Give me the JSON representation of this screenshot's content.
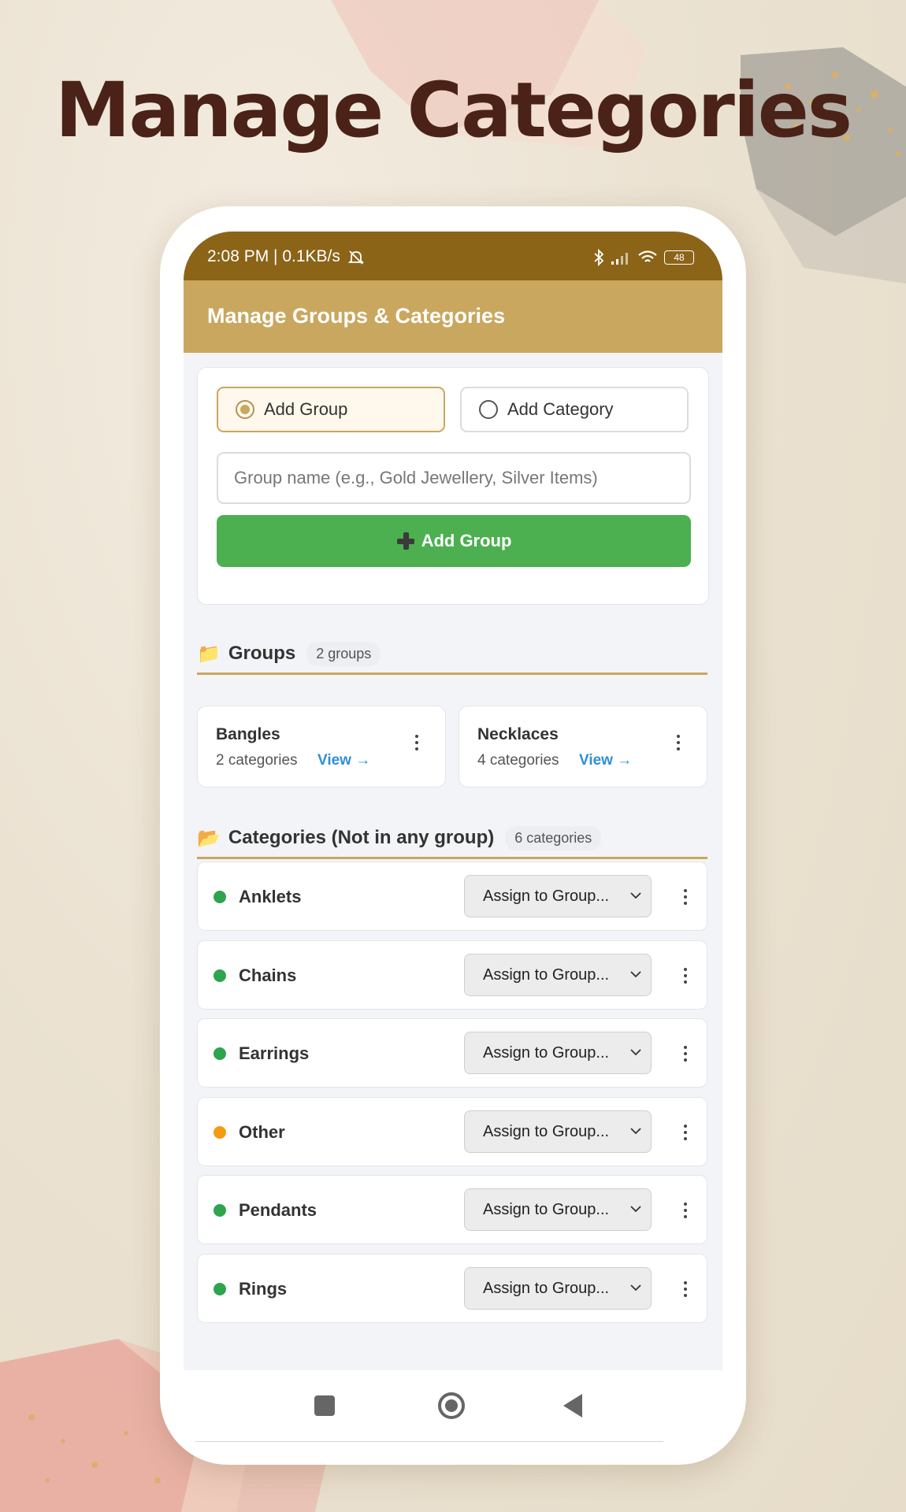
{
  "hero": {
    "title": "Manage Categories"
  },
  "status_bar": {
    "time": "2:08 PM | 0.1KB/s",
    "battery": "48"
  },
  "app_bar": {
    "title": "Manage Groups & Categories"
  },
  "form": {
    "mode_options": [
      {
        "label": "Add Group",
        "selected": true
      },
      {
        "label": "Add Category",
        "selected": false
      }
    ],
    "name_input": {
      "placeholder": "Group name (e.g., Gold Jewellery, Silver Items)",
      "value": ""
    },
    "submit_label": "Add Group"
  },
  "groups_section": {
    "emoji": "📁",
    "title": "Groups",
    "count": "2 groups",
    "items": [
      {
        "name": "Bangles",
        "count": "2 categories",
        "view": "View →"
      },
      {
        "name": "Necklaces",
        "count": "4 categories",
        "view": "View →"
      }
    ]
  },
  "categories_section": {
    "emoji": "📂",
    "title": "Categories (Not in any group)",
    "count": "6 categories",
    "assign_label": "Assign to Group...",
    "items": [
      {
        "name": "Anklets",
        "dot_color": "#2ea44f"
      },
      {
        "name": "Chains",
        "dot_color": "#2ea44f"
      },
      {
        "name": "Earrings",
        "dot_color": "#2ea44f"
      },
      {
        "name": "Other",
        "dot_color": "#f39c12"
      },
      {
        "name": "Pendants",
        "dot_color": "#2ea44f"
      },
      {
        "name": "Rings",
        "dot_color": "#2ea44f"
      }
    ]
  },
  "colors": {
    "status_bar": "#8b6418",
    "app_bar": "#c9a75f",
    "accent_gold": "#c9a75f",
    "button_green": "#4caf50",
    "link_blue": "#2e8fd6"
  }
}
